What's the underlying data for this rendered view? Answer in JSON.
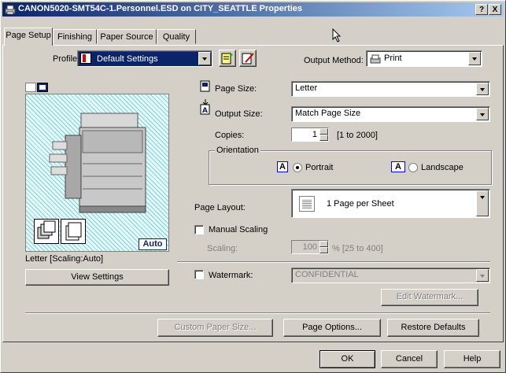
{
  "window": {
    "title": "CANON5020-SMT54C-1.Personnel.ESD on CITY_SEATTLE Properties",
    "help_btn": "?",
    "close_btn": "X"
  },
  "tabs": [
    "Page Setup",
    "Finishing",
    "Paper Source",
    "Quality"
  ],
  "profile": {
    "label": "Profile:",
    "value": "Default Settings"
  },
  "output_method": {
    "label": "Output Method:",
    "value": "Print"
  },
  "preview": {
    "auto_badge": "Auto",
    "status": "Letter [Scaling:Auto]",
    "view_settings": "View Settings"
  },
  "page_size": {
    "label": "Page Size:",
    "value": "Letter"
  },
  "output_size": {
    "label": "Output Size:",
    "value": "Match Page Size"
  },
  "copies": {
    "label": "Copies:",
    "value": "1",
    "range": "[1 to 2000]"
  },
  "orientation": {
    "group_label": "Orientation",
    "icon_letter": "A",
    "portrait": "Portrait",
    "landscape": "Landscape",
    "selected": "Portrait"
  },
  "page_layout": {
    "label": "Page Layout:",
    "value": "1 Page per Sheet"
  },
  "manual_scaling": {
    "label": "Manual Scaling",
    "checked": false
  },
  "scaling": {
    "label": "Scaling:",
    "value": "100",
    "range": "% [25 to 400]"
  },
  "watermark": {
    "label": "Watermark:",
    "value": "CONFIDENTIAL",
    "checked": false
  },
  "edit_watermark": "Edit Watermark...",
  "buttons": {
    "custom_paper_size": "Custom Paper Size...",
    "page_options": "Page Options...",
    "restore_defaults": "Restore Defaults",
    "ok": "OK",
    "cancel": "Cancel",
    "help": "Help"
  }
}
